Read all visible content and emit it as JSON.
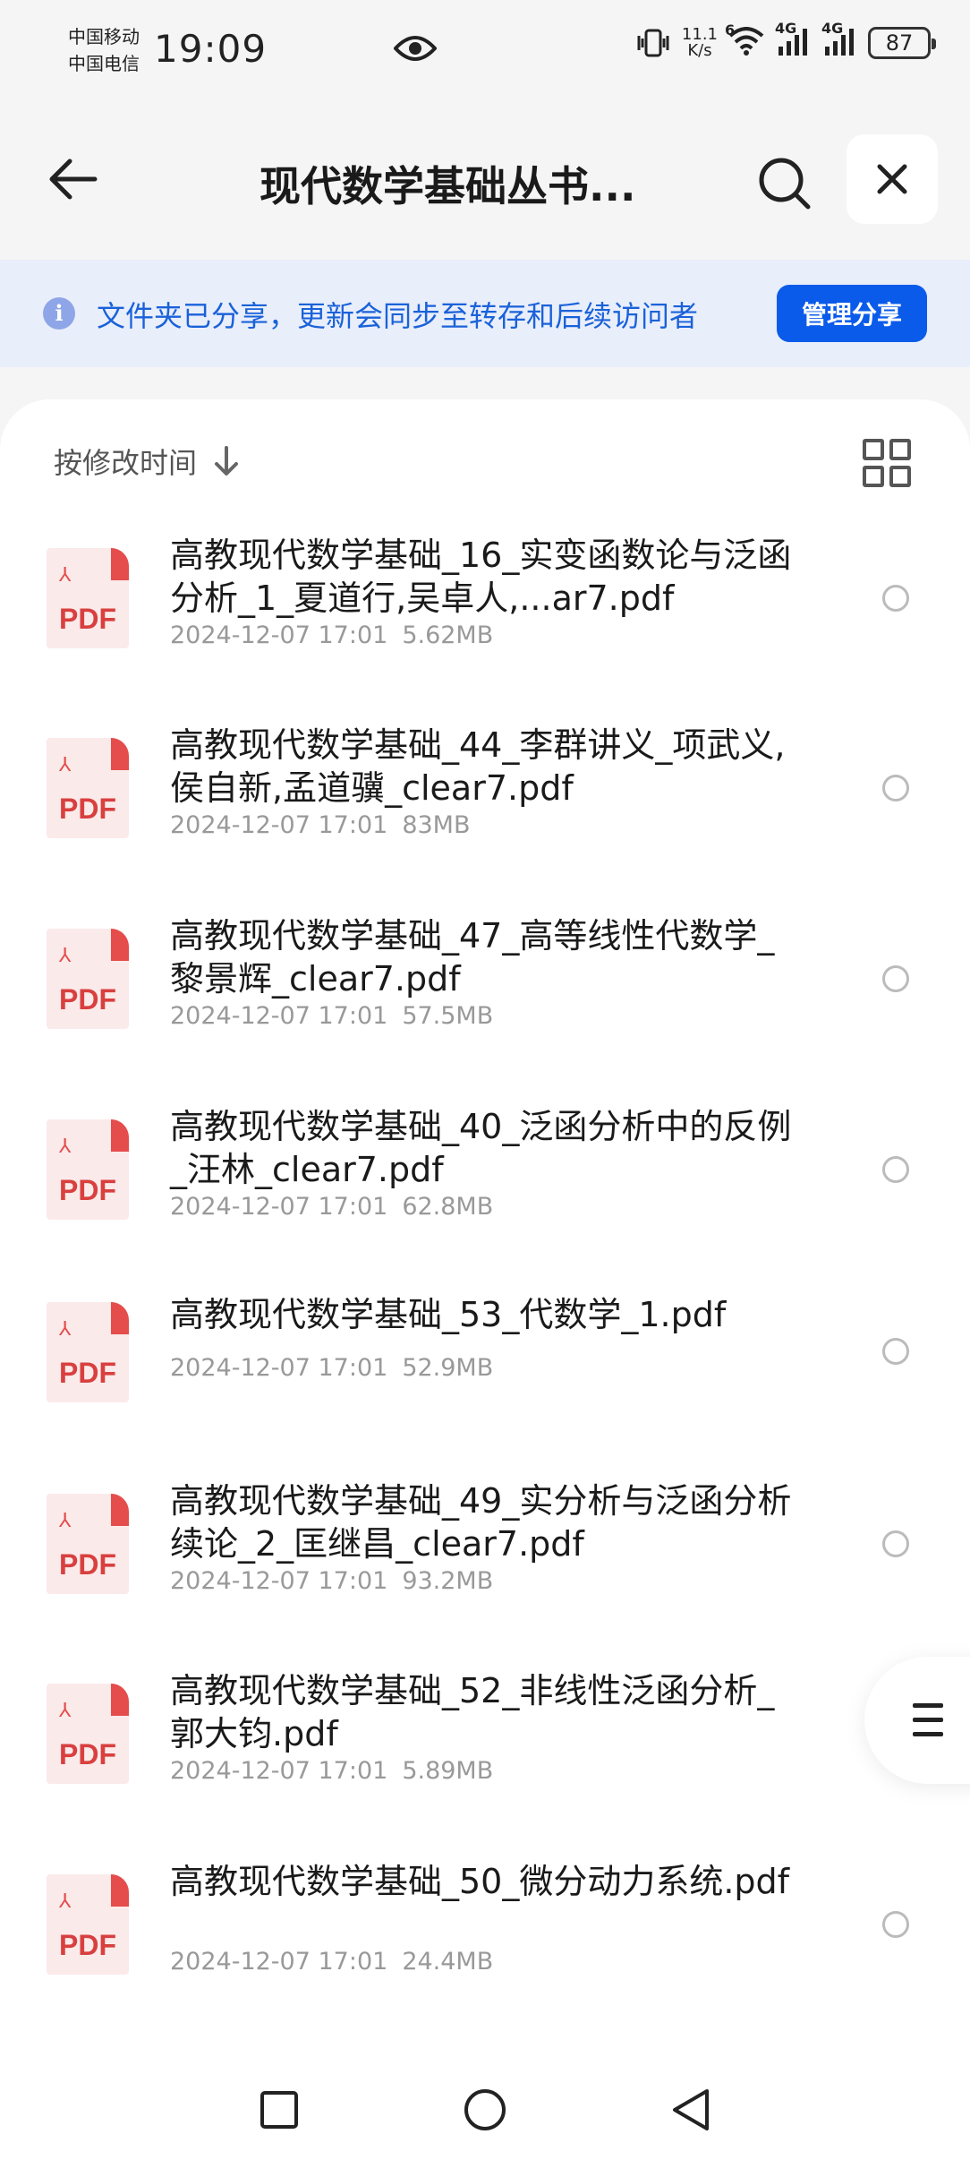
{
  "status_bar": {
    "carrier_1": "中国移动",
    "carrier_2": "中国电信",
    "time": "19:09",
    "net_speed_value": "11.1",
    "net_speed_unit": "K/s",
    "wifi_badge": "6",
    "signal_1": "4G",
    "signal_2": "4G",
    "battery": "87"
  },
  "header": {
    "title": "现代数学基础丛书...",
    "icons": {
      "back": "back-arrow-icon",
      "search": "search-icon",
      "close": "close-icon"
    }
  },
  "banner": {
    "text": "文件夹已分享，更新会同步至转存和后续访问者",
    "manage_label": "管理分享",
    "accent": "#0a5bea"
  },
  "sort": {
    "label": "按修改时间",
    "direction_icon": "arrow-down-icon",
    "view_icon": "grid-view-icon"
  },
  "file_icon_label": "PDF",
  "files": [
    {
      "name": "高教现代数学基础_16_实变函数论与泛函分析_1_夏道行,吴卓人,...ar7.pdf",
      "date": "2024-12-07 17:01",
      "size": "5.62MB"
    },
    {
      "name": "高教现代数学基础_44_李群讲义_项武义,侯自新,孟道骥_clear7.pdf",
      "date": "2024-12-07 17:01",
      "size": "83MB"
    },
    {
      "name": "高教现代数学基础_47_高等线性代数学_黎景辉_clear7.pdf",
      "date": "2024-12-07 17:01",
      "size": "57.5MB"
    },
    {
      "name": "高教现代数学基础_40_泛函分析中的反例_汪林_clear7.pdf",
      "date": "2024-12-07 17:01",
      "size": "62.8MB"
    },
    {
      "name": "高教现代数学基础_53_代数学_1.pdf",
      "date": "2024-12-07 17:01",
      "size": "52.9MB"
    },
    {
      "name": "高教现代数学基础_49_实分析与泛函分析续论_2_匡继昌_clear7.pdf",
      "date": "2024-12-07 17:01",
      "size": "93.2MB"
    },
    {
      "name": "高教现代数学基础_52_非线性泛函分析_郭大钧.pdf",
      "date": "2024-12-07 17:01",
      "size": "5.89MB"
    },
    {
      "name": "高教现代数学基础_50_微分动力系统.pdf",
      "date": "2024-12-07 17:01",
      "size": "24.4MB"
    }
  ],
  "floating_menu_icon": "menu-icon",
  "nav": {
    "icons": [
      "recents-square-icon",
      "home-circle-icon",
      "back-triangle-icon"
    ]
  }
}
